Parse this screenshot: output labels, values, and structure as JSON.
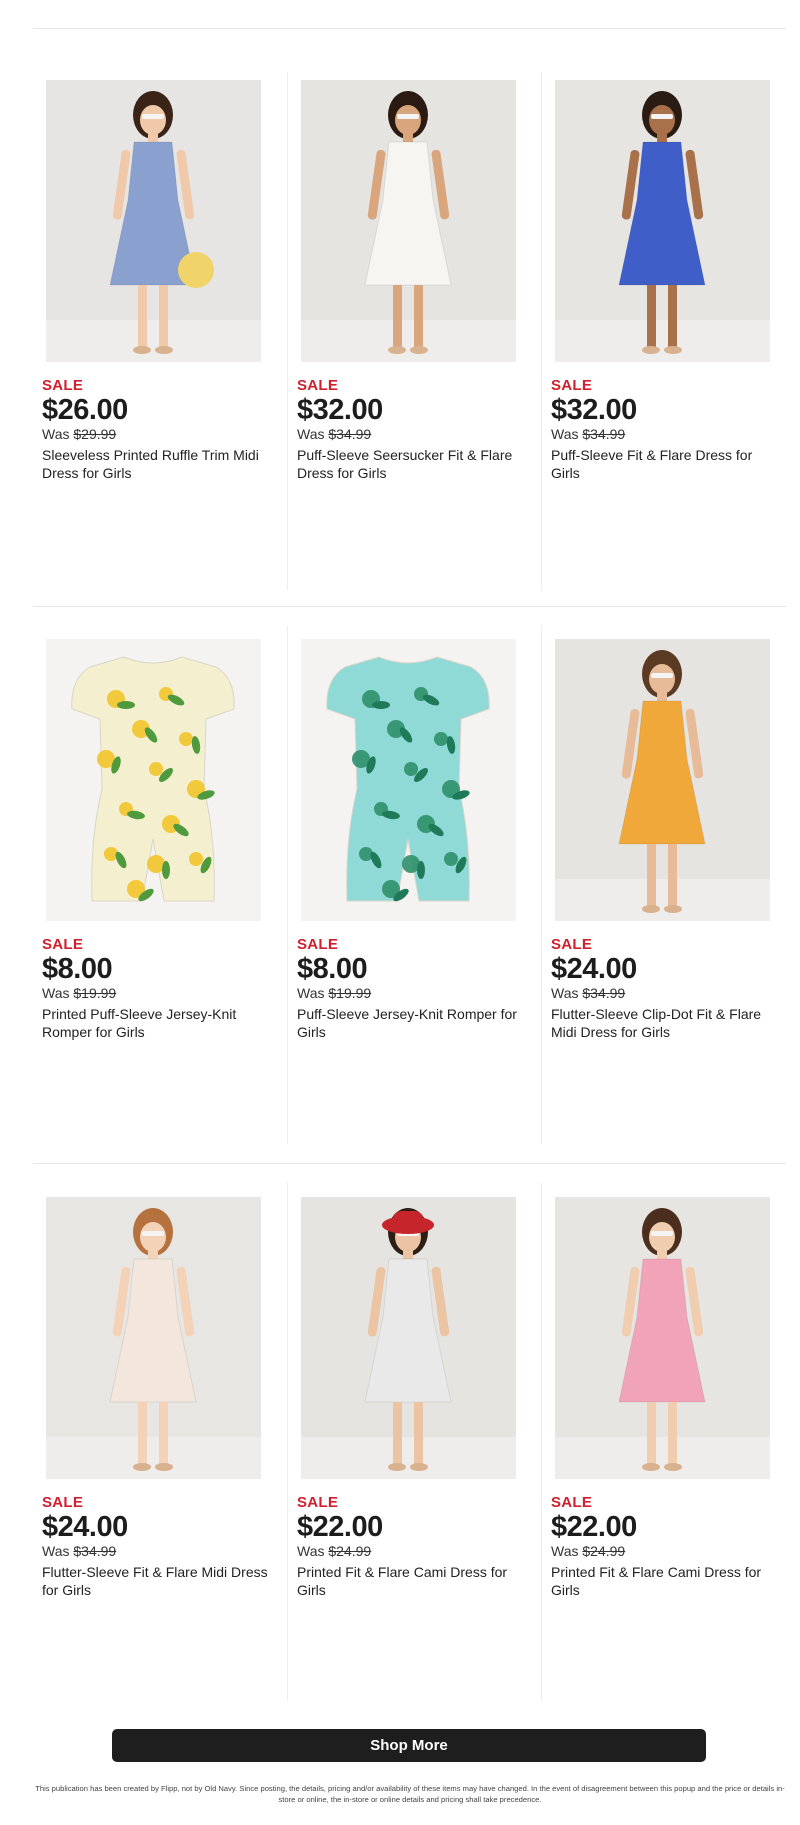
{
  "products": [
    {
      "sale_label": "SALE",
      "price": "$26.00",
      "was_prefix": "Was",
      "was_price": "$29.99",
      "name": "Sleeveless Printed Ruffle Trim Midi Dress for Girls",
      "dress_color": "#8aa1cf",
      "bg": "#e7e5e3"
    },
    {
      "sale_label": "SALE",
      "price": "$32.00",
      "was_prefix": "Was",
      "was_price": "$34.99",
      "name": "Puff-Sleeve Seersucker Fit & Flare Dress for Girls",
      "dress_color": "#f6f5f1",
      "bg": "#e6e4e1"
    },
    {
      "sale_label": "SALE",
      "price": "$32.00",
      "was_prefix": "Was",
      "was_price": "$34.99",
      "name": "Puff-Sleeve Fit & Flare Dress for Girls",
      "dress_color": "#3f5ec7",
      "bg": "#e7e5e2"
    },
    {
      "sale_label": "SALE",
      "price": "$8.00",
      "was_prefix": "Was",
      "was_price": "$19.99",
      "name": "Printed Puff-Sleeve Jersey-Knit Romper for Girls",
      "dress_color": "#f3efcf",
      "bg": "#f4f3f1"
    },
    {
      "sale_label": "SALE",
      "price": "$8.00",
      "was_prefix": "Was",
      "was_price": "$19.99",
      "name": "Puff-Sleeve Jersey-Knit Romper for Girls",
      "dress_color": "#8fd9d6",
      "bg": "#f4f3f1"
    },
    {
      "sale_label": "SALE",
      "price": "$24.00",
      "was_prefix": "Was",
      "was_price": "$34.99",
      "name": "Flutter-Sleeve Clip-Dot Fit & Flare Midi Dress for Girls",
      "dress_color": "#f0a83a",
      "bg": "#e6e4e1"
    },
    {
      "sale_label": "SALE",
      "price": "$24.00",
      "was_prefix": "Was",
      "was_price": "$34.99",
      "name": "Flutter-Sleeve Fit & Flare Midi Dress for Girls",
      "dress_color": "#f2e6dd",
      "bg": "#e8e6e3"
    },
    {
      "sale_label": "SALE",
      "price": "$22.00",
      "was_prefix": "Was",
      "was_price": "$24.99",
      "name": "Printed Fit & Flare Cami Dress for Girls",
      "dress_color": "#e9e9e9",
      "bg": "#e6e4e1"
    },
    {
      "sale_label": "SALE",
      "price": "$22.00",
      "was_prefix": "Was",
      "was_price": "$24.99",
      "name": "Printed Fit & Flare Cami Dress for Girls",
      "dress_color": "#f1a3b8",
      "bg": "#e7e5e2"
    }
  ],
  "shop_more_label": "Shop More",
  "footer_text": "This publication has been created by Flipp, not by Old Navy. Since posting, the details, pricing and/or availability of these items may have changed. In the event of disagreement between this popup and the price or details in-store or online, the in-store or online details and pricing shall take precedence."
}
